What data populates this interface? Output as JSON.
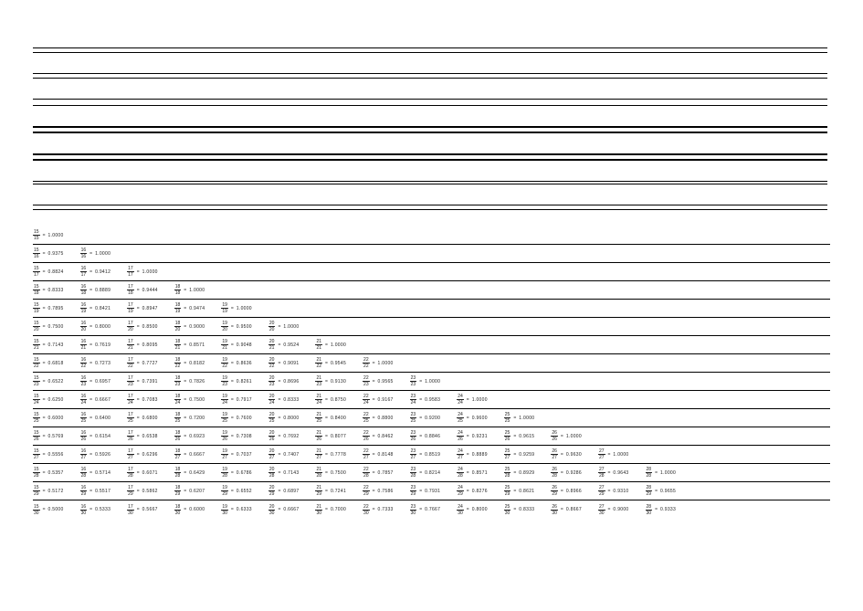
{
  "chart_data": {
    "type": "table",
    "title": "",
    "description": "Triangular table of decimal equivalents for fractions n/d, for denominators d = 15 to 30 and numerators n = 15 up to d.",
    "start_numerator": 15,
    "rows": [
      {
        "denominator": 15,
        "values": [
          1.0
        ]
      },
      {
        "denominator": 16,
        "values": [
          0.9375,
          1.0
        ]
      },
      {
        "denominator": 17,
        "values": [
          0.8824,
          0.9412,
          1.0
        ]
      },
      {
        "denominator": 18,
        "values": [
          0.8333,
          0.8889,
          0.9444,
          1.0
        ]
      },
      {
        "denominator": 19,
        "values": [
          0.7895,
          0.8421,
          0.8947,
          0.9474,
          1.0
        ]
      },
      {
        "denominator": 20,
        "values": [
          0.75,
          0.8,
          0.85,
          0.9,
          0.95,
          1.0
        ]
      },
      {
        "denominator": 21,
        "values": [
          0.7143,
          0.7619,
          0.8095,
          0.8571,
          0.9048,
          0.9524,
          1.0
        ]
      },
      {
        "denominator": 22,
        "values": [
          0.6818,
          0.7273,
          0.7727,
          0.8182,
          0.8636,
          0.9091,
          0.9545,
          1.0
        ]
      },
      {
        "denominator": 23,
        "values": [
          0.6522,
          0.6957,
          0.7391,
          0.7826,
          0.8261,
          0.8696,
          0.913,
          0.9565,
          1.0
        ]
      },
      {
        "denominator": 24,
        "values": [
          0.625,
          0.6667,
          0.7083,
          0.75,
          0.7917,
          0.8333,
          0.875,
          0.9167,
          0.9583,
          1.0
        ]
      },
      {
        "denominator": 25,
        "values": [
          0.6,
          0.64,
          0.68,
          0.72,
          0.76,
          0.8,
          0.84,
          0.88,
          0.92,
          0.96,
          1.0
        ]
      },
      {
        "denominator": 26,
        "values": [
          0.5769,
          0.6154,
          0.6538,
          0.6923,
          0.7308,
          0.7692,
          0.8077,
          0.8462,
          0.8846,
          0.9231,
          0.9615,
          1.0
        ]
      },
      {
        "denominator": 27,
        "values": [
          0.5556,
          0.5926,
          0.6296,
          0.6667,
          0.7037,
          0.7407,
          0.7778,
          0.8148,
          0.8519,
          0.8889,
          0.9259,
          0.963,
          1.0
        ]
      },
      {
        "denominator": 28,
        "values": [
          0.5357,
          0.5714,
          0.6071,
          0.6429,
          0.6786,
          0.7143,
          0.75,
          0.7857,
          0.8214,
          0.8571,
          0.8929,
          0.9286,
          0.9643,
          1.0
        ]
      },
      {
        "denominator": 29,
        "values": [
          0.5172,
          0.5517,
          0.5862,
          0.6207,
          0.6552,
          0.6897,
          0.7241,
          0.7586,
          0.7931,
          0.8276,
          0.8621,
          0.8966,
          0.931,
          0.9655
        ]
      },
      {
        "denominator": 30,
        "values": [
          0.5,
          0.5333,
          0.5667,
          0.6,
          0.6333,
          0.6667,
          0.7,
          0.7333,
          0.7667,
          0.8,
          0.8333,
          0.8667,
          0.9,
          0.9333
        ]
      }
    ]
  },
  "symbols": {
    "equals": "="
  }
}
